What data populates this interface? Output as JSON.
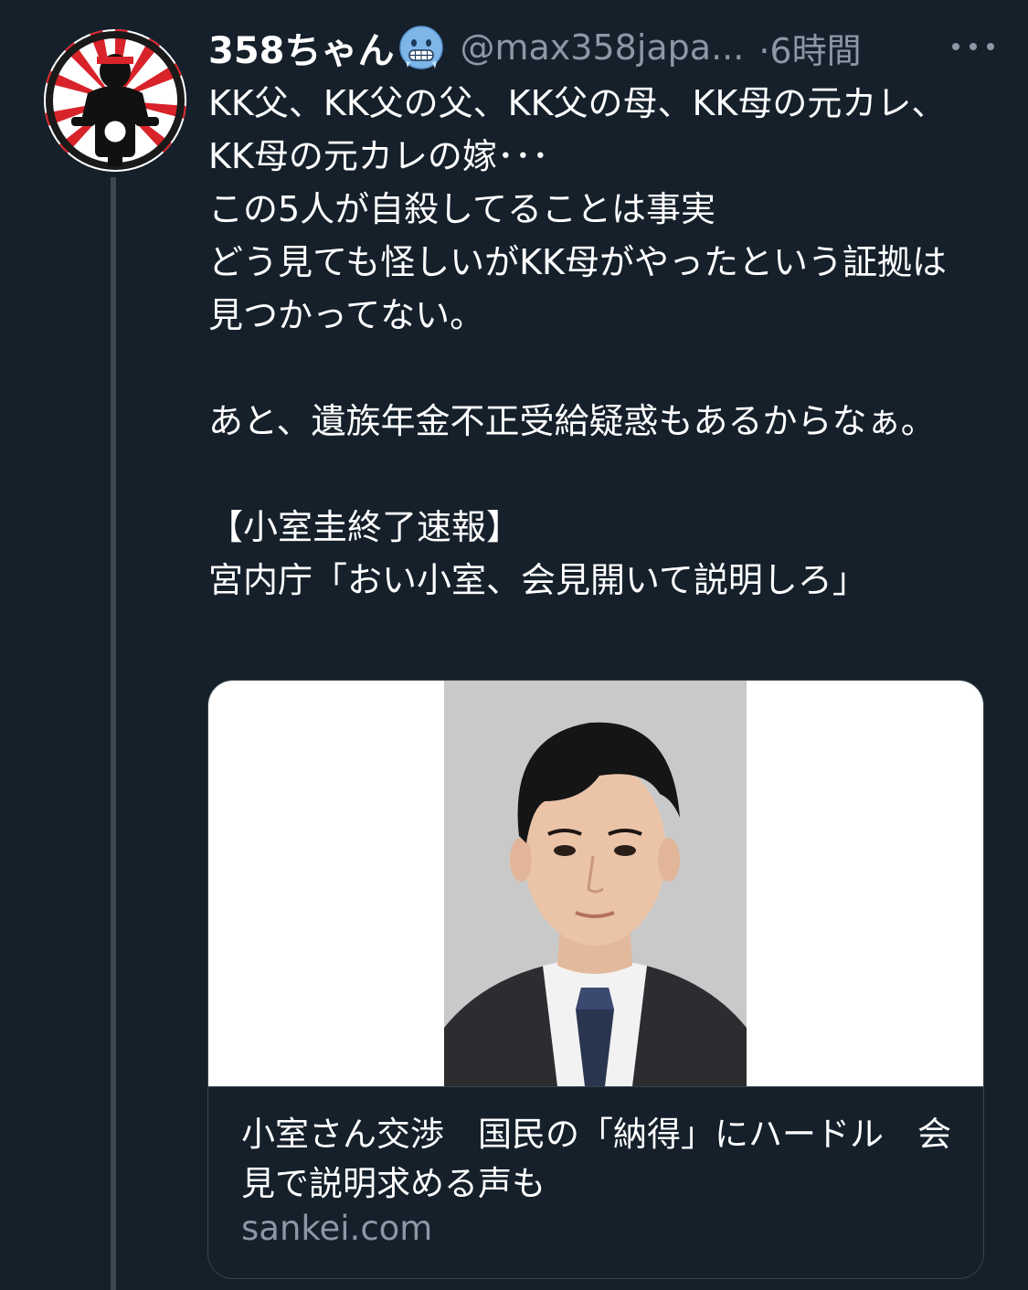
{
  "tweet": {
    "display_name": "358ちゃん",
    "name_emoji": "cold-face-emoji",
    "handle": "@max358japa...",
    "time": "·6時間",
    "text_lines": [
      "KK父、KK父の父、KK父の母、KK母の元カレ、KK母の元カレの嫁･･･",
      "この5人が自殺してることは事実",
      "どう見ても怪しいがKK母がやったという証拠は見つかってない。",
      "",
      "あと、遺族年金不正受給疑惑もあるからなぁ。",
      "",
      "【小室圭終了速報】",
      "宮内庁「おい小室、会見開いて説明しろ」"
    ]
  },
  "card": {
    "title": "小室さん交渉　国民の「納得」にハードル　会見で説明求める声も",
    "domain": "sankei.com"
  },
  "icons": {
    "avatar": "motorcycle-rider-avatar",
    "more": "more-dots-icon"
  },
  "colors": {
    "background": "#15202b",
    "text": "#ffffff",
    "secondary": "#8b98a5",
    "border": "#38444d",
    "avatar_red": "#d8232a"
  }
}
